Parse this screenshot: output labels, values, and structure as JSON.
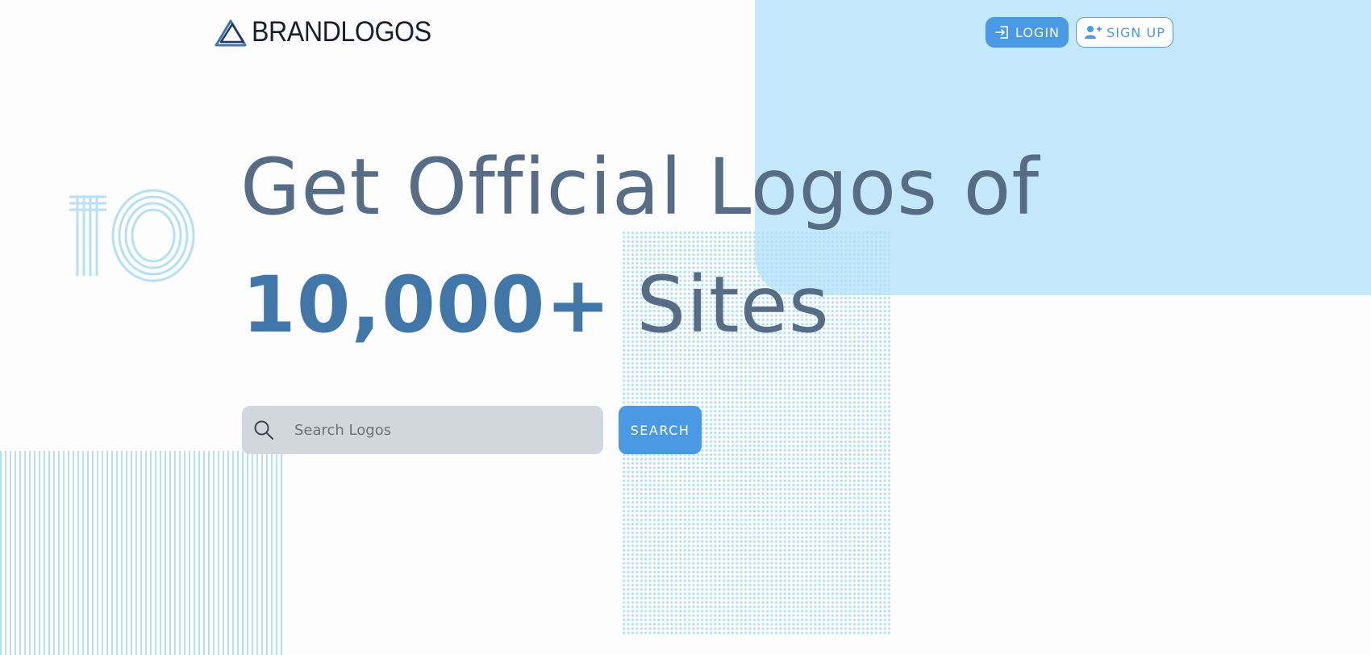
{
  "brand": {
    "name": "BRANDLOGOS"
  },
  "nav": {
    "login_label": "LOGIN",
    "signup_label": "SIGN UP"
  },
  "hero": {
    "line1": "Get Official Logos of",
    "count": "10,000",
    "plus": "+",
    "sites": " Sites",
    "decor_text": "10"
  },
  "search": {
    "placeholder": "Search Logos",
    "value": "",
    "button_label": "SEARCH"
  },
  "colors": {
    "accent": "#4a99e4",
    "heading": "#566d85",
    "heading_emphasis": "#4177a8",
    "panel_bg": "#c4e8fc",
    "pattern": "#b7e0f7",
    "search_bg": "#d1d7dd"
  },
  "icons": {
    "logo": "triangle-logo-icon",
    "login": "login-icon",
    "signup": "user-plus-icon",
    "search": "search-icon"
  }
}
